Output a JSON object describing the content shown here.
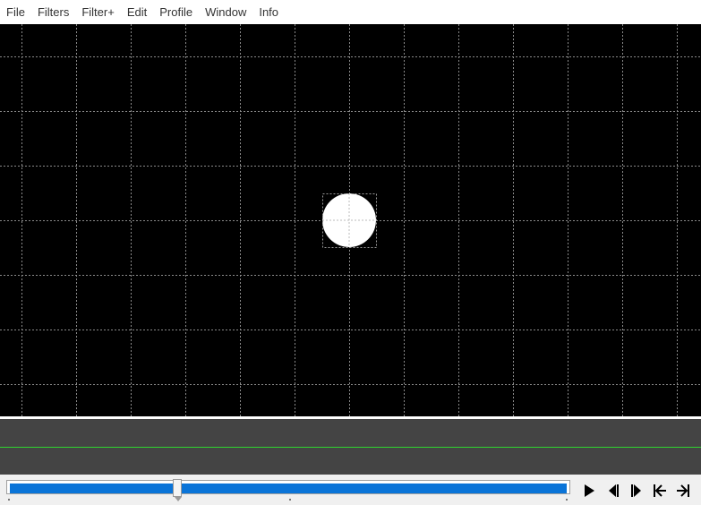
{
  "menu": {
    "items": [
      {
        "id": "file",
        "label": "File"
      },
      {
        "id": "filters",
        "label": "Filters"
      },
      {
        "id": "filter-plus",
        "label": "Filter+"
      },
      {
        "id": "edit",
        "label": "Edit"
      },
      {
        "id": "profile",
        "label": "Profile"
      },
      {
        "id": "window",
        "label": "Window"
      },
      {
        "id": "info",
        "label": "Info"
      }
    ]
  },
  "viewport": {
    "background": "#000000",
    "grid_color": "#8a8a8a",
    "object": {
      "shape": "circle",
      "fill": "#ffffff",
      "selected": true
    }
  },
  "timeline": {
    "track_color": "#444444",
    "line_color": "#2fd52f"
  },
  "transport": {
    "scrubber_color": "#0a74d8",
    "position_fraction": 0.3,
    "buttons": [
      {
        "id": "play",
        "icon": "play-icon"
      },
      {
        "id": "step-back",
        "icon": "step-back-icon"
      },
      {
        "id": "step-forward",
        "icon": "step-forward-icon"
      },
      {
        "id": "go-start",
        "icon": "go-to-start-icon"
      },
      {
        "id": "go-end",
        "icon": "go-to-end-icon"
      }
    ]
  }
}
